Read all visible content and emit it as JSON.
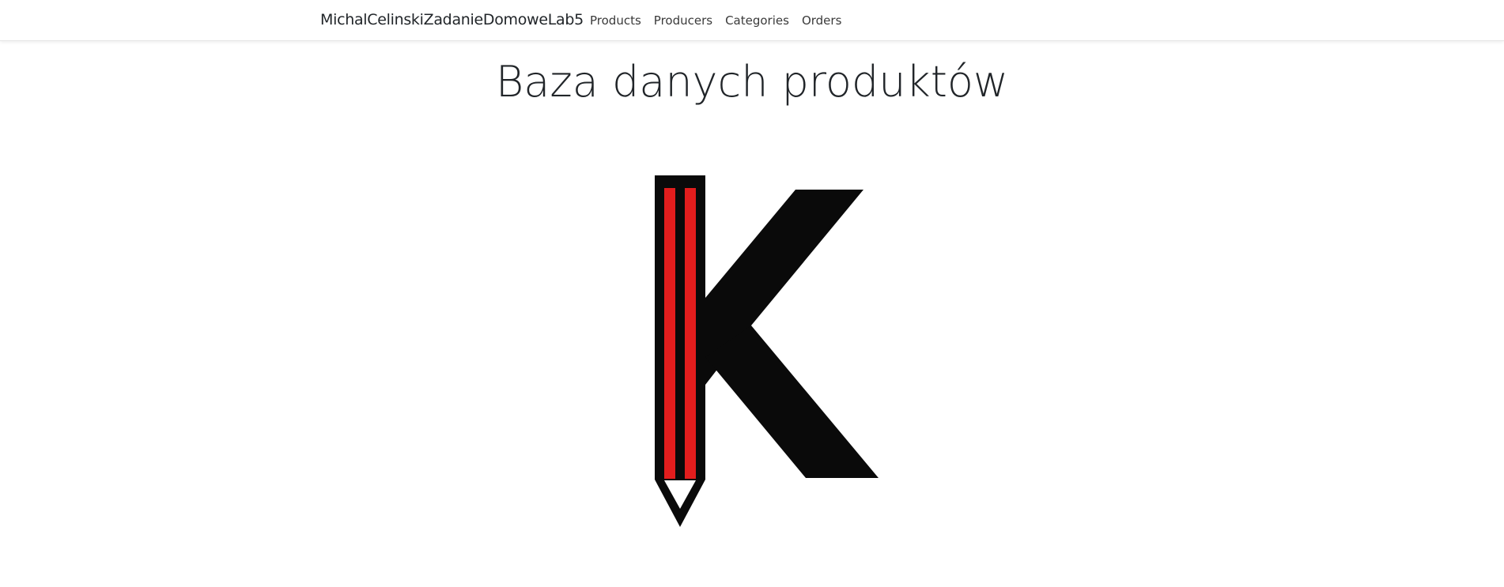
{
  "navbar": {
    "brand": "MichalCelinskiZadanieDomoweLab5",
    "links": [
      {
        "label": "Products"
      },
      {
        "label": "Producers"
      },
      {
        "label": "Categories"
      },
      {
        "label": "Orders"
      }
    ]
  },
  "main": {
    "title": "Baza danych produktów",
    "logo": {
      "icon": "pencil-k-logo",
      "colors": {
        "primary": "#0a0a0a",
        "accent": "#e21d1d"
      }
    }
  }
}
